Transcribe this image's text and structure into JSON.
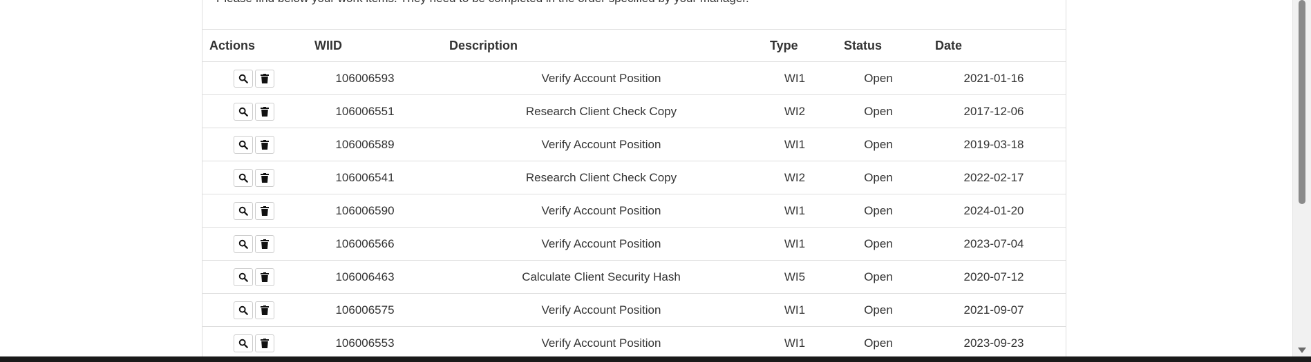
{
  "intro_text": "Please find below your work items. They need to be completed in the order specified by your manager.",
  "table": {
    "headers": {
      "actions": "Actions",
      "wiid": "WIID",
      "description": "Description",
      "type": "Type",
      "status": "Status",
      "date": "Date"
    },
    "rows": [
      {
        "wiid": "106006593",
        "description": "Verify Account Position",
        "type": "WI1",
        "status": "Open",
        "date": "2021-01-16"
      },
      {
        "wiid": "106006551",
        "description": "Research Client Check Copy",
        "type": "WI2",
        "status": "Open",
        "date": "2017-12-06"
      },
      {
        "wiid": "106006589",
        "description": "Verify Account Position",
        "type": "WI1",
        "status": "Open",
        "date": "2019-03-18"
      },
      {
        "wiid": "106006541",
        "description": "Research Client Check Copy",
        "type": "WI2",
        "status": "Open",
        "date": "2022-02-17"
      },
      {
        "wiid": "106006590",
        "description": "Verify Account Position",
        "type": "WI1",
        "status": "Open",
        "date": "2024-01-20"
      },
      {
        "wiid": "106006566",
        "description": "Verify Account Position",
        "type": "WI1",
        "status": "Open",
        "date": "2023-07-04"
      },
      {
        "wiid": "106006463",
        "description": "Calculate Client Security Hash",
        "type": "WI5",
        "status": "Open",
        "date": "2020-07-12"
      },
      {
        "wiid": "106006575",
        "description": "Verify Account Position",
        "type": "WI1",
        "status": "Open",
        "date": "2021-09-07"
      },
      {
        "wiid": "106006553",
        "description": "Verify Account Position",
        "type": "WI1",
        "status": "Open",
        "date": "2023-09-23"
      }
    ]
  },
  "icons": {
    "view": "search-icon",
    "delete": "trash-icon"
  }
}
